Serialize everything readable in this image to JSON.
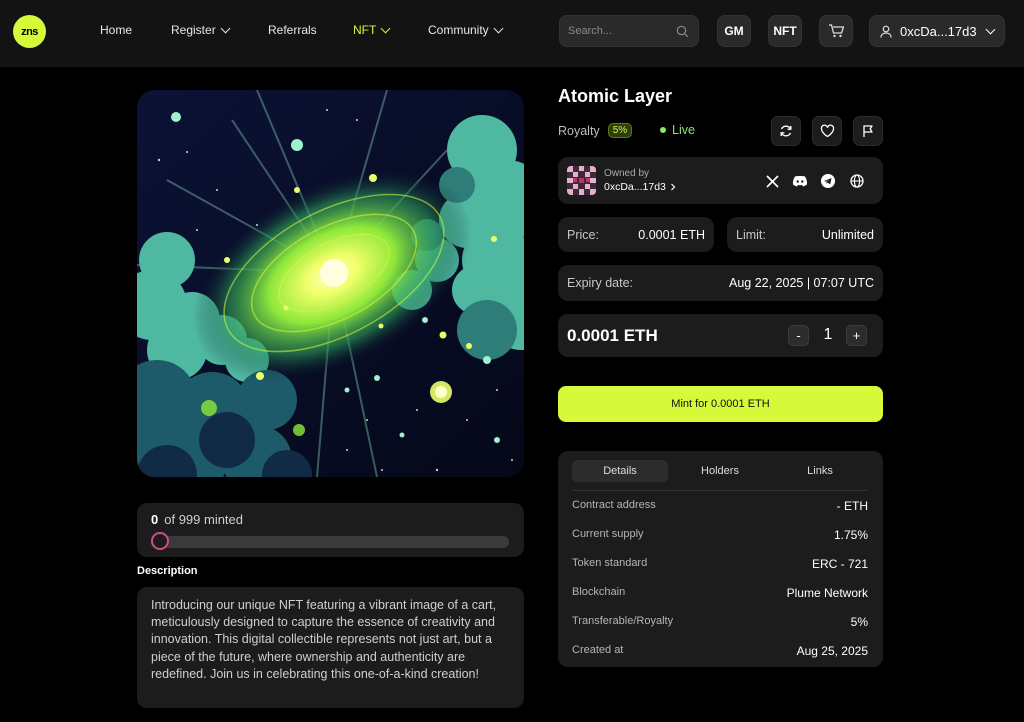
{
  "brand": {
    "logo_text": "zns",
    "accent": "#d6f93a"
  },
  "nav": {
    "items": [
      {
        "label": "Home"
      },
      {
        "label": "Register"
      },
      {
        "label": "Referrals"
      },
      {
        "label": "NFT"
      },
      {
        "label": "Community"
      }
    ],
    "search_placeholder": "Search...",
    "gm_label": "GM",
    "nft_label": "NFT",
    "wallet": "0xcDa...17d3"
  },
  "nft": {
    "title": "Atomic Layer",
    "royalty_label": "Royalty",
    "royalty_value": "5%",
    "status": "Live",
    "owned_by_label": "Owned by",
    "owner": "0xcDa...17d3",
    "price_label": "Price:",
    "price_value": "0.0001 ETH",
    "limit_label": "Limit:",
    "limit_value": "Unlimited",
    "expiry_label": "Expiry date:",
    "expiry_value": "Aug 22, 2025 | 07:07 UTC",
    "total_price": "0.0001 ETH",
    "quantity": "1",
    "minus": "-",
    "plus": "+",
    "mint_button": "Mint for 0.0001 ETH"
  },
  "progress": {
    "minted": "0",
    "of_text": "of 999 minted",
    "fraction": 0
  },
  "description": {
    "title": "Description",
    "text": "Introducing our unique NFT featuring a vibrant image of a cart, meticulously designed to capture the essence of creativity and innovation. This digital collectible represents not just art, but a piece of the future, where ownership and authenticity are redefined. Join us in celebrating this one-of-a-kind creation!"
  },
  "details": {
    "tabs": [
      {
        "label": "Details"
      },
      {
        "label": "Holders"
      },
      {
        "label": "Links"
      }
    ],
    "rows": [
      {
        "key": "Contract address",
        "value": "- ETH"
      },
      {
        "key": "Current supply",
        "value": "1.75%"
      },
      {
        "key": "Token standard",
        "value": "ERC - 721"
      },
      {
        "key": "Blockchain",
        "value": "Plume Network"
      },
      {
        "key": "Transferable/Royalty",
        "value": "5%"
      },
      {
        "key": "Created at",
        "value": "Aug 25, 2025"
      }
    ]
  }
}
